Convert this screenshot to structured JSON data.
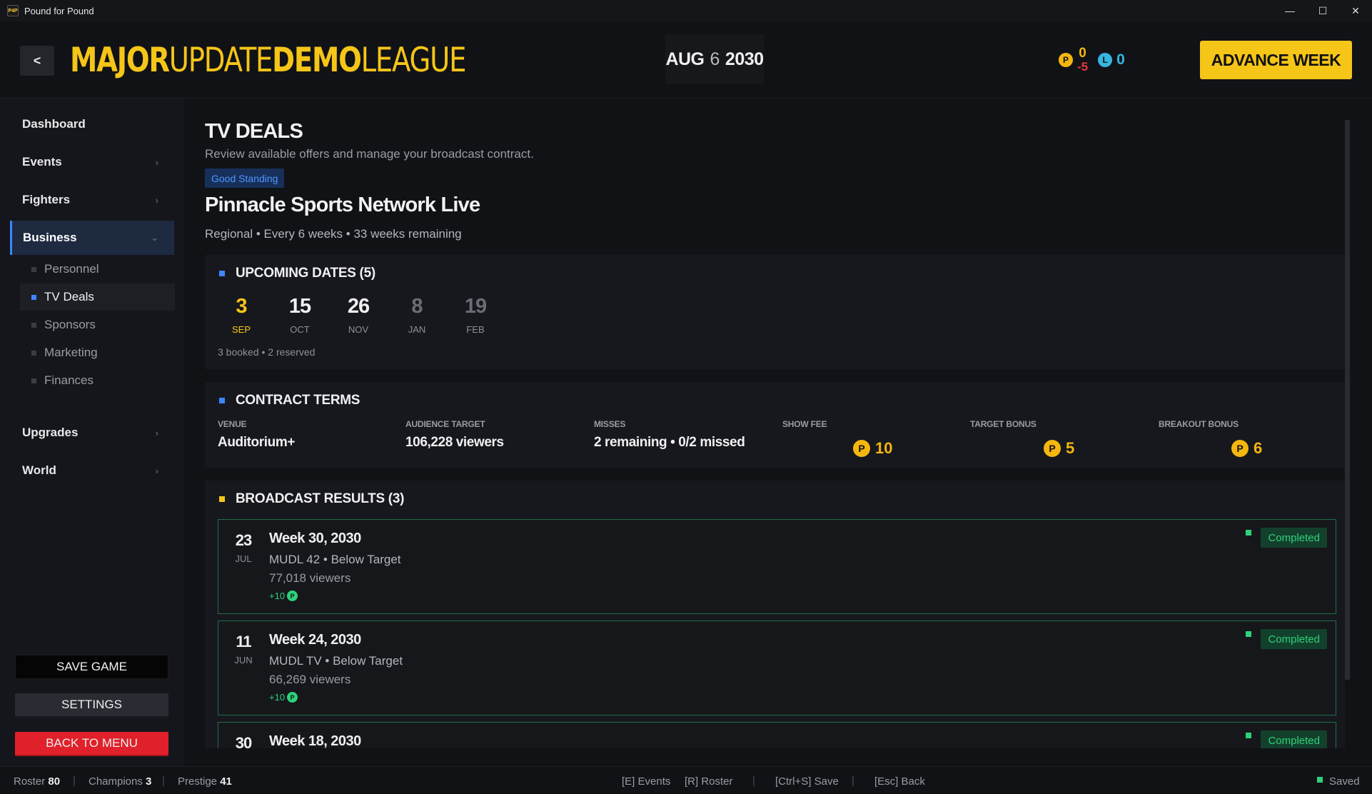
{
  "window": {
    "title": "Pound for Pound",
    "icon_text": "P4P"
  },
  "header": {
    "back_label": "<",
    "league_parts": [
      "MAJOR",
      "UPDATE",
      "DEMO",
      "LEAGUE"
    ],
    "date_month": "AUG",
    "date_day": "6",
    "date_year": "2030",
    "prestige_value": "0",
    "prestige_delta": "-5",
    "legacy_value": "0",
    "advance_label": "ADVANCE WEEK"
  },
  "sidebar": {
    "items": [
      {
        "label": "Dashboard"
      },
      {
        "label": "Events"
      },
      {
        "label": "Fighters"
      },
      {
        "label": "Business"
      },
      {
        "label": "Upgrades"
      },
      {
        "label": "World"
      }
    ],
    "business_sub": [
      "Personnel",
      "TV Deals",
      "Sponsors",
      "Marketing",
      "Finances"
    ],
    "save_label": "SAVE GAME",
    "settings_label": "SETTINGS",
    "menu_label": "BACK TO MENU"
  },
  "page": {
    "title": "TV DEALS",
    "subtitle": "Review available offers and manage your broadcast contract.",
    "standing": "Good Standing",
    "network": "Pinnacle Sports Network Live",
    "network_details": "Regional • Every 6 weeks • 33 weeks remaining"
  },
  "upcoming": {
    "title": "UPCOMING DATES (5)",
    "dates": [
      {
        "day": "3",
        "month": "SEP"
      },
      {
        "day": "15",
        "month": "OCT"
      },
      {
        "day": "26",
        "month": "NOV"
      },
      {
        "day": "8",
        "month": "JAN"
      },
      {
        "day": "19",
        "month": "FEB"
      }
    ],
    "note": "3 booked • 2 reserved"
  },
  "contract": {
    "title": "CONTRACT TERMS",
    "venue_label": "VENUE",
    "venue": "Auditorium+",
    "audience_label": "AUDIENCE TARGET",
    "audience": "106,228 viewers",
    "misses_label": "MISSES",
    "misses": "2 remaining • 0/2 missed",
    "show_fee_label": "SHOW FEE",
    "show_fee": "10",
    "target_bonus_label": "TARGET BONUS",
    "target_bonus": "5",
    "breakout_bonus_label": "BREAKOUT BONUS",
    "breakout_bonus": "6"
  },
  "results": {
    "title": "BROADCAST RESULTS (3)",
    "items": [
      {
        "day": "23",
        "month": "JUL",
        "title": "Week 30, 2030",
        "line": "MUDL 42 • Below Target",
        "viewers": "77,018 viewers",
        "gain": "+10",
        "status": "Completed"
      },
      {
        "day": "11",
        "month": "JUN",
        "title": "Week 24, 2030",
        "line": "MUDL TV • Below Target",
        "viewers": "66,269 viewers",
        "gain": "+10",
        "status": "Completed"
      },
      {
        "day": "30",
        "month": "",
        "title": "Week 18, 2030",
        "line": "",
        "viewers": "",
        "gain": "",
        "status": "Completed"
      }
    ]
  },
  "statusbar": {
    "roster_label": "Roster",
    "roster": "80",
    "champions_label": "Champions",
    "champions": "3",
    "prestige_label": "Prestige",
    "prestige": "41",
    "hint_events": "[E] Events",
    "hint_roster": "[R] Roster",
    "hint_save": "[Ctrl+S] Save",
    "hint_back": "[Esc] Back",
    "saved": "Saved"
  },
  "icons": {
    "coin_p": "P",
    "coin_l": "L"
  },
  "colors": {
    "accent": "#f5c518",
    "blue": "#3d86ff",
    "green": "#2ed17a",
    "red": "#e0202a"
  }
}
